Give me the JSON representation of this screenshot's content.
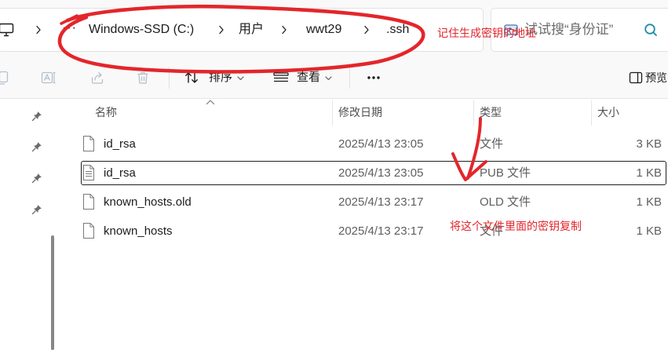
{
  "address_bar": {
    "root_icon": "monitor-icon",
    "separator_icon": "chevron-right-icon",
    "overflow_label": "···",
    "crumbs": [
      "Windows-SSD (C:)",
      "用户",
      "wwt29",
      ".ssh"
    ]
  },
  "search": {
    "icon": "search-highlight-icon",
    "placeholder": "试试搜“身份证”",
    "action_icon": "search-icon"
  },
  "command_bar": {
    "actions": [
      {
        "icon": "copy-icon",
        "enabled": false
      },
      {
        "icon": "rename-icon",
        "enabled": false
      },
      {
        "icon": "share-icon",
        "enabled": false
      },
      {
        "icon": "delete-icon",
        "enabled": false
      }
    ],
    "sort": {
      "icon": "sort-icon",
      "label": "排序",
      "dropdown_icon": "chevron-down-icon"
    },
    "view": {
      "icon": "view-icon",
      "label": "查看",
      "dropdown_icon": "chevron-down-icon"
    },
    "more_icon": "more-icon",
    "details_pane": {
      "icon": "details-pane-icon",
      "label": "预览"
    }
  },
  "nav": {
    "pinned_items": [
      {
        "icon": "pin-icon"
      },
      {
        "icon": "pin-icon"
      },
      {
        "icon": "pin-icon"
      },
      {
        "icon": "pin-icon"
      }
    ]
  },
  "columns": {
    "name": "名称",
    "modified": "修改日期",
    "type": "类型",
    "size": "大小",
    "sort_indicator_icon": "chevron-up-icon"
  },
  "files": [
    {
      "icon": "file-icon",
      "name": "id_rsa",
      "modified": "2025/4/13 23:05",
      "type": "文件",
      "size": "3 KB",
      "focused": false
    },
    {
      "icon": "text-file-icon",
      "name": "id_rsa",
      "modified": "2025/4/13 23:05",
      "type": "PUB 文件",
      "size": "1 KB",
      "focused": true
    },
    {
      "icon": "file-icon",
      "name": "known_hosts.old",
      "modified": "2025/4/13 23:17",
      "type": "OLD 文件",
      "size": "1 KB",
      "focused": false
    },
    {
      "icon": "file-icon",
      "name": "known_hosts",
      "modified": "2025/4/13 23:17",
      "type": "文件",
      "size": "1 KB",
      "focused": false
    }
  ],
  "annotations": {
    "address_note": "记住生成密钥的地址",
    "file_note": "将这个文件里面的密钥复制",
    "color": "#e3262b"
  },
  "colors": {
    "focus_border": "#1f1f1f",
    "disabled_icon": "#b5c0cb",
    "scrollbar_thumb": "#868686"
  }
}
